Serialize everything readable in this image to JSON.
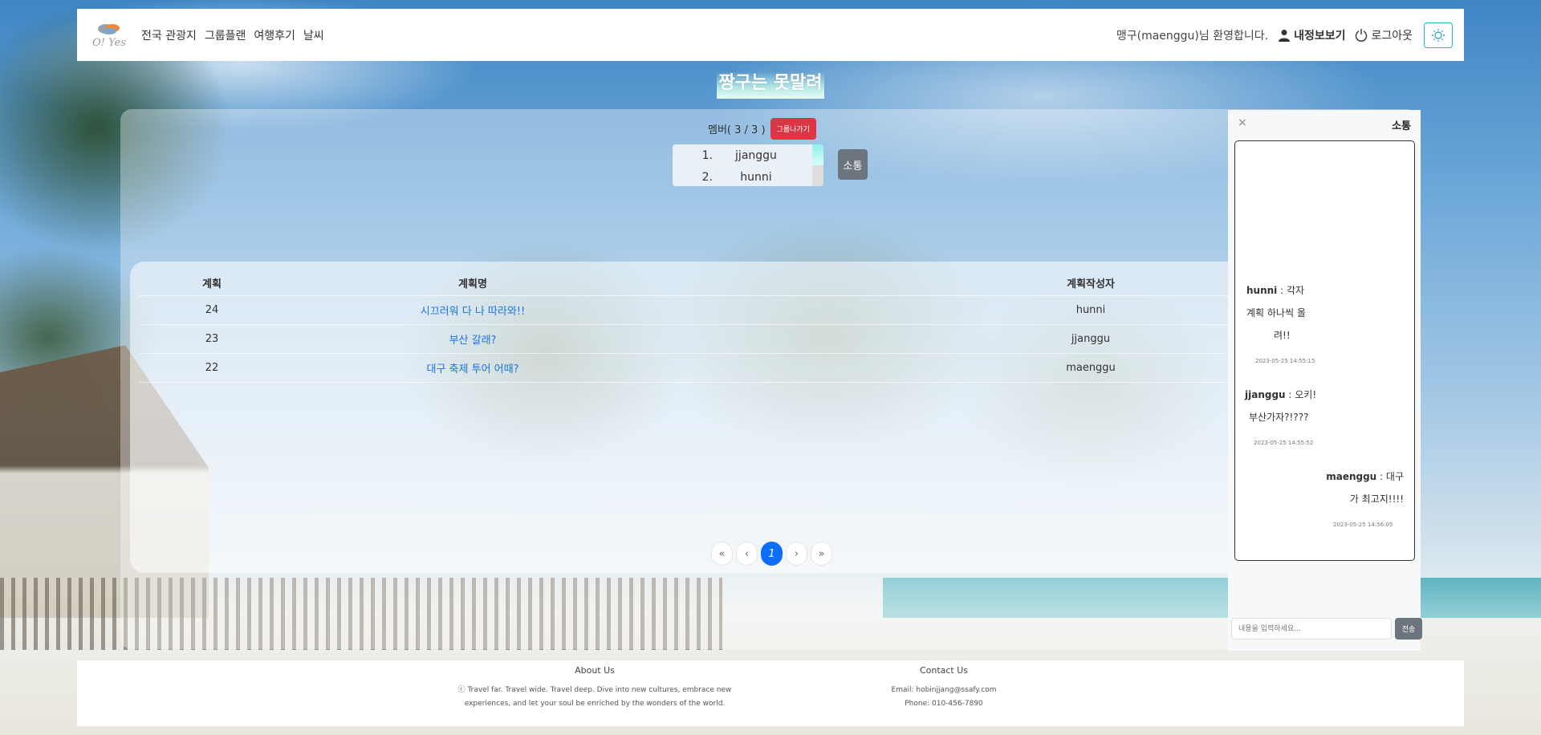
{
  "colors": {
    "accent": "#0d6efd",
    "danger": "#dc3545",
    "secondary": "#6c757d",
    "teal": "#2bb3c0",
    "link": "#1a73e8"
  },
  "header": {
    "logo_text": "O! Yes",
    "nav": [
      "전국 관광지",
      "그룹플랜",
      "여행후기",
      "날씨"
    ],
    "welcome": "맹구(maenggu)님 환영합니다.",
    "profile_label": "내정보보기",
    "logout_label": "로그아웃",
    "icon_button": "settings-icon"
  },
  "group": {
    "title": "짱구는 못말려",
    "members_label": "멤버( 3 / 3 )",
    "leave_label": "그룹나가기",
    "members": [
      {
        "num": "1.",
        "name": "jjanggu"
      },
      {
        "num": "2.",
        "name": "hunni"
      }
    ],
    "talk_button": "소통"
  },
  "plans": {
    "headers": [
      "계획",
      "계획명",
      "계획작성자"
    ],
    "rows": [
      {
        "no": "24",
        "title": "시끄러워 다 나 따라와!!",
        "author": "hunni"
      },
      {
        "no": "23",
        "title": "부산 갈래?",
        "author": "jjanggu"
      },
      {
        "no": "22",
        "title": "대구 축제 투어 어때?",
        "author": "maenggu"
      }
    ],
    "pagination": [
      "«",
      "‹",
      "1",
      "›",
      "»"
    ],
    "current_page": "1"
  },
  "chat": {
    "close": "×",
    "title": "소통",
    "messages": [
      {
        "user": "hunni",
        "text_lines": [
          " : 각자",
          "계획 하나씩 올",
          "려!!"
        ],
        "time": "2023-05-25 14:55:15"
      },
      {
        "user": "jjanggu",
        "text_lines": [
          " : 오키!",
          "부산가자?!???"
        ],
        "time": "2023-05-25 14:55:52"
      },
      {
        "user": "maenggu",
        "text_lines": [
          " : 대구",
          "가 최고지!!!!"
        ],
        "time": "2023-05-25 14:56:05"
      }
    ],
    "input_placeholder": "내용을 입력하세요...",
    "send_label": "전송"
  },
  "footer": {
    "about_title": "About Us",
    "about_text": "ⓒ Travel far. Travel wide. Travel deep. Dive into new cultures, embrace new experiences, and let your soul be enriched by the wonders of the world.",
    "contact_title": "Contact Us",
    "email": "Email: hobinjjang@ssafy.com",
    "phone": "Phone: 010-456-7890"
  }
}
